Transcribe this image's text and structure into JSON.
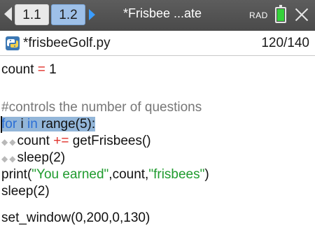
{
  "tabs": [
    {
      "label": "1.1"
    },
    {
      "label": "1.2"
    }
  ],
  "document_title": "*Frisbee ...ate",
  "angle_mode": "RAD",
  "file": {
    "name": "*frisbeeGolf.py",
    "line_count": "120/140"
  },
  "code": {
    "l1": {
      "a": "count ",
      "b": "=",
      "c": " 1"
    },
    "l2": "#controls the number of questions",
    "l3": {
      "a": "for",
      "b": " i ",
      "c": "in",
      "d": " range(5):"
    },
    "l4": {
      "indent": "◆◆",
      "a": "count ",
      "b": "+=",
      "c": " getFrisbees()"
    },
    "l5": {
      "indent": "◆◆",
      "a": "sleep(2)"
    },
    "l6": {
      "a": "print(",
      "b": "\"You earned\"",
      "c": ",count,",
      "d": "\"frisbees\"",
      "e": ")"
    },
    "l7": "sleep(2)",
    "l8": "set_window(0,200,0,130)"
  },
  "colors": {
    "keyword": "#2b6fd6",
    "operator": "#e0322b",
    "string": "#1f9b2e",
    "comment": "#777777",
    "selection": "#93b6d9",
    "battery": "#35d23b"
  },
  "icons": [
    "prev-page-icon",
    "next-page-icon",
    "battery-icon",
    "close-icon",
    "python-file-icon"
  ]
}
